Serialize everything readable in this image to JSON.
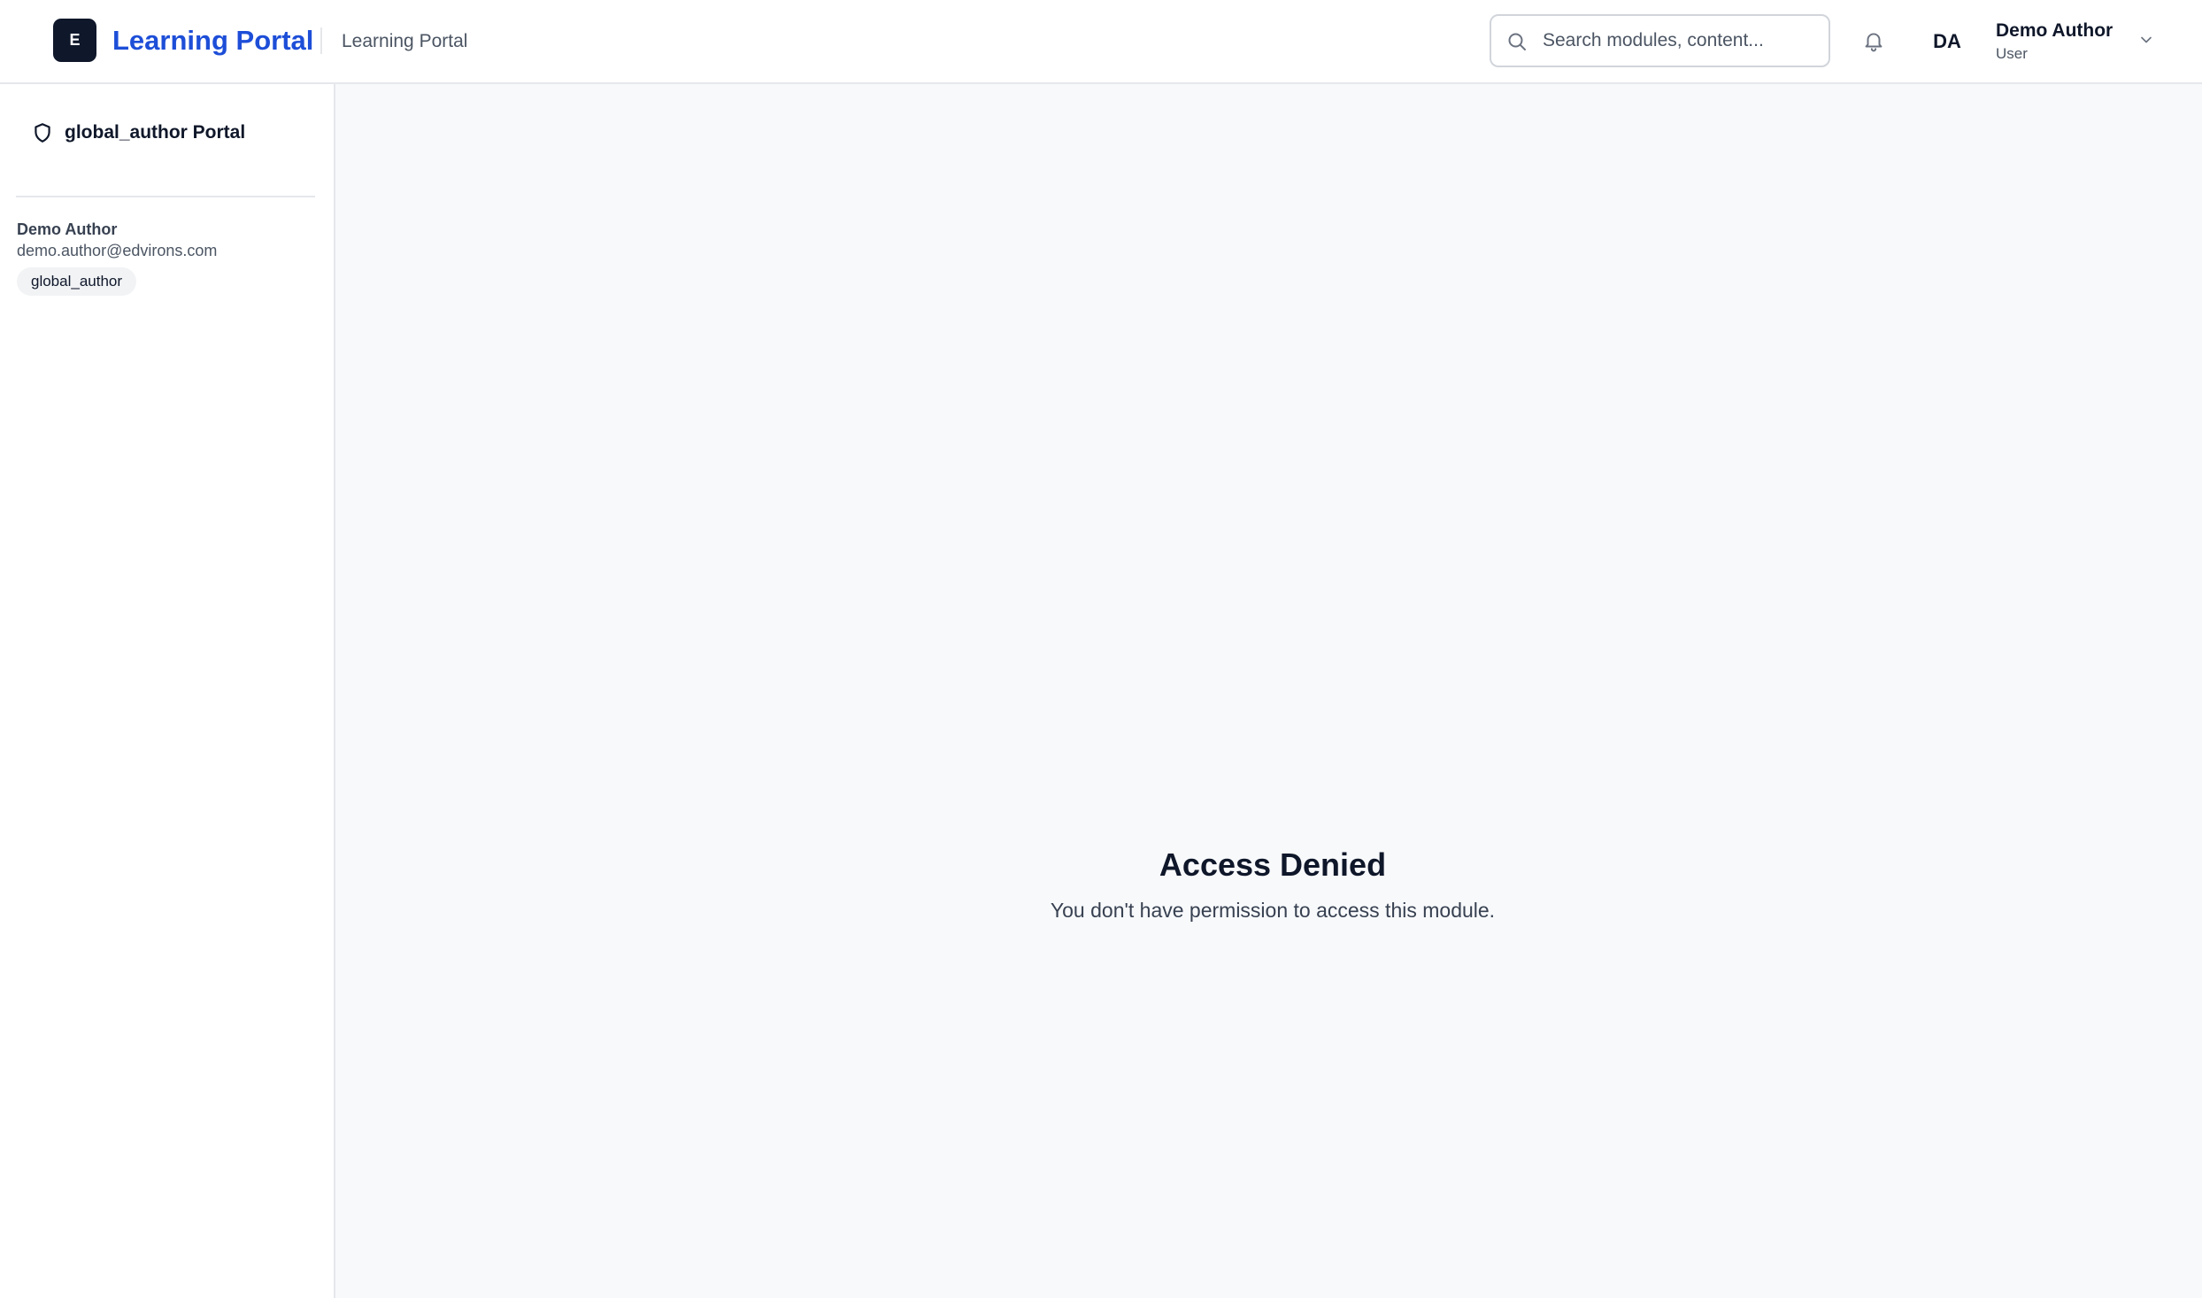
{
  "header": {
    "logo_letter": "E",
    "brand_title": "Learning Portal",
    "brand_subtitle": "Learning Portal",
    "search": {
      "placeholder": "Search modules, content...",
      "icon": "search-icon"
    },
    "notification_icon": "bell-icon",
    "user": {
      "initials": "DA",
      "name": "Demo Author",
      "role": "User",
      "menu_icon": "chevron-down-icon"
    }
  },
  "sidebar": {
    "portal_icon": "shield-icon",
    "portal_label": "global_author Portal",
    "user_name": "Demo Author",
    "user_email": "demo.author@edvirons.com",
    "role_badge": "global_author"
  },
  "main": {
    "title": "Access Denied",
    "message": "You don't have permission to access this module."
  },
  "colors": {
    "brand": "#1d4ed8",
    "logo_bg": "#0f172a",
    "page_bg": "#f8f9fb",
    "border": "#e5e7eb"
  }
}
